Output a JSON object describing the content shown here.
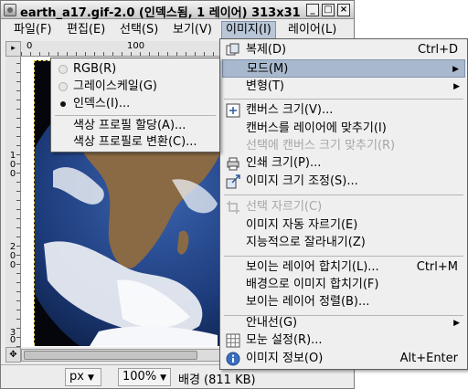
{
  "window": {
    "title": "earth_a17.gif-2.0 (인덱스됨, 1 레이어) 313x31",
    "buttons": {
      "minimize": "_",
      "maximize": "□",
      "close": "×"
    }
  },
  "menubar": [
    {
      "label": "파일(F)"
    },
    {
      "label": "편집(E)"
    },
    {
      "label": "선택(S)"
    },
    {
      "label": "보기(V)"
    },
    {
      "label": "이미지(I)",
      "active": true
    },
    {
      "label": "레이어(L)"
    }
  ],
  "rulers": {
    "h_ticks": [
      "0",
      "100"
    ],
    "v_ticks": [
      "1",
      "0",
      "0",
      "2",
      "0",
      "0",
      "3",
      "0",
      "0"
    ]
  },
  "statusbar": {
    "unit": "px",
    "zoom": "100%",
    "label": "배경 (811 KB)"
  },
  "image_menu": {
    "items": [
      {
        "label": "복제(D)",
        "accel": "Ctrl+D",
        "icon": "duplicate-icon"
      },
      {
        "label": "모드(M)",
        "submenu": true,
        "highlighted": true
      },
      {
        "label": "변형(T)",
        "submenu": true
      },
      {
        "label": "캔버스 크기(V)...",
        "icon": "canvas-size-icon"
      },
      {
        "label": "캔버스를 레이어에 맞추기(I)"
      },
      {
        "label": "선택에 캔버스 크기 맞추기(R)",
        "disabled": true
      },
      {
        "label": "인쇄 크기(P)...",
        "icon": "print-size-icon"
      },
      {
        "label": "이미지 크기 조정(S)...",
        "icon": "scale-image-icon"
      },
      {
        "label": "선택 자르기(C)",
        "disabled": true,
        "icon": "crop-icon"
      },
      {
        "label": "이미지 자동 자르기(E)"
      },
      {
        "label": "지능적으로 잘라내기(Z)"
      },
      {
        "label": "보이는 레이어 합치기(L)...",
        "accel": "Ctrl+M"
      },
      {
        "label": "배경으로 이미지 합치기(F)"
      },
      {
        "label": "보이는 레이어 정렬(B)..."
      },
      {
        "label": "안내선(G)",
        "submenu": true
      },
      {
        "label": "모눈 설정(R)...",
        "icon": "grid-icon"
      },
      {
        "label": "이미지 정보(O)",
        "accel": "Alt+Enter",
        "icon": "info-icon"
      }
    ]
  },
  "mode_menu": {
    "items": [
      {
        "label": "RGB(R)",
        "checked": false
      },
      {
        "label": "그레이스케일(G)",
        "checked": false
      },
      {
        "label": "인덱스(I)...",
        "checked": true
      },
      {
        "label": "색상 프로필 할당(A)..."
      },
      {
        "label": "색상 프로필로 변환(C)..."
      }
    ]
  },
  "colors": {
    "highlight": "#a9b9cd",
    "menu_bg": "#efefef",
    "disabled_text": "#a6a6a6",
    "space": "#05060c",
    "ocean": "#1c3b7a",
    "land": "#8a6a44"
  }
}
